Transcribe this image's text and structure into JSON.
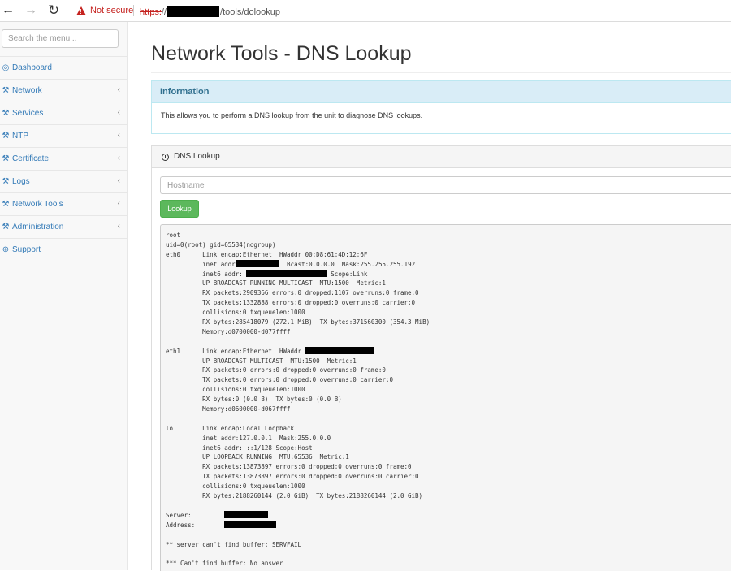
{
  "browser": {
    "back_icon": "arrow-left-icon",
    "forward_icon": "arrow-right-icon",
    "reload_icon": "reload-icon",
    "security_label": "Not secure",
    "url_scheme": "https:",
    "url_sep": "//",
    "url_path": "/tools/dolookup"
  },
  "sidebar": {
    "search_placeholder": "Search the menu...",
    "items": [
      {
        "label": "Dashboard",
        "icon": "tachometer-icon",
        "glyph": "◎",
        "has_submenu": false
      },
      {
        "label": "Network",
        "icon": "wrench-icon",
        "glyph": "⚒",
        "has_submenu": true
      },
      {
        "label": "Services",
        "icon": "wrench-icon",
        "glyph": "⚒",
        "has_submenu": true
      },
      {
        "label": "NTP",
        "icon": "wrench-icon",
        "glyph": "⚒",
        "has_submenu": true
      },
      {
        "label": "Certificate",
        "icon": "wrench-icon",
        "glyph": "⚒",
        "has_submenu": true
      },
      {
        "label": "Logs",
        "icon": "wrench-icon",
        "glyph": "⚒",
        "has_submenu": true
      },
      {
        "label": "Network Tools",
        "icon": "wrench-icon",
        "glyph": "⚒",
        "has_submenu": true
      },
      {
        "label": "Administration",
        "icon": "wrench-icon",
        "glyph": "⚒",
        "has_submenu": true
      },
      {
        "label": "Support",
        "icon": "life-ring-icon",
        "glyph": "⊕",
        "has_submenu": false
      }
    ],
    "chevron": "‹"
  },
  "page": {
    "title": "Network Tools - DNS Lookup"
  },
  "info_panel": {
    "heading": "Information",
    "body": "This allows you to perform a DNS lookup from the unit to diagnose DNS lookups."
  },
  "dns_panel": {
    "heading": "DNS Lookup",
    "hostname_placeholder": "Hostname",
    "lookup_label": "Lookup",
    "output": [
      {
        "text": "root"
      },
      {
        "text": "uid=0(root) gid=65534(nogroup)"
      },
      {
        "text": "eth0      Link encap:Ethernet  HWaddr 00:D8:61:4D:12:6F"
      },
      {
        "text": "          inet addr",
        "redact_chars": 12,
        "tail": "  Bcast:0.0.0.0  Mask:255.255.255.192"
      },
      {
        "text": "          inet6 addr: ",
        "redact_chars": 22,
        "tail": " Scope:Link"
      },
      {
        "text": "          UP BROADCAST RUNNING MULTICAST  MTU:1500  Metric:1"
      },
      {
        "text": "          RX packets:2909366 errors:0 dropped:1107 overruns:0 frame:0"
      },
      {
        "text": "          TX packets:1332888 errors:0 dropped:0 overruns:0 carrier:0"
      },
      {
        "text": "          collisions:0 txqueuelen:1000"
      },
      {
        "text": "          RX bytes:285418079 (272.1 MiB)  TX bytes:371560300 (354.3 MiB)"
      },
      {
        "text": "          Memory:d0700000-d077ffff"
      },
      {
        "text": ""
      },
      {
        "text": "eth1      Link encap:Ethernet  HWaddr ",
        "redact_chars": 19,
        "tail": ""
      },
      {
        "text": "          UP BROADCAST MULTICAST  MTU:1500  Metric:1"
      },
      {
        "text": "          RX packets:0 errors:0 dropped:0 overruns:0 frame:0"
      },
      {
        "text": "          TX packets:0 errors:0 dropped:0 overruns:0 carrier:0"
      },
      {
        "text": "          collisions:0 txqueuelen:1000"
      },
      {
        "text": "          RX bytes:0 (0.0 B)  TX bytes:0 (0.0 B)"
      },
      {
        "text": "          Memory:d0600000-d067ffff"
      },
      {
        "text": ""
      },
      {
        "text": "lo        Link encap:Local Loopback"
      },
      {
        "text": "          inet addr:127.0.0.1  Mask:255.0.0.0"
      },
      {
        "text": "          inet6 addr: ::1/128 Scope:Host"
      },
      {
        "text": "          UP LOOPBACK RUNNING  MTU:65536  Metric:1"
      },
      {
        "text": "          RX packets:13873897 errors:0 dropped:0 overruns:0 frame:0"
      },
      {
        "text": "          TX packets:13873897 errors:0 dropped:0 overruns:0 carrier:0"
      },
      {
        "text": "          collisions:0 txqueuelen:1000"
      },
      {
        "text": "          RX bytes:2188260144 (2.0 GiB)  TX bytes:2188260144 (2.0 GiB)"
      },
      {
        "text": ""
      },
      {
        "text": "Server:         ",
        "redact_chars": 12,
        "tail": ""
      },
      {
        "text": "Address:        ",
        "redact_chars": 14,
        "tail": ""
      },
      {
        "text": ""
      },
      {
        "text": "** server can't find buffer: SERVFAIL"
      },
      {
        "text": ""
      },
      {
        "text": "*** Can't find buffer: No answer"
      }
    ]
  }
}
